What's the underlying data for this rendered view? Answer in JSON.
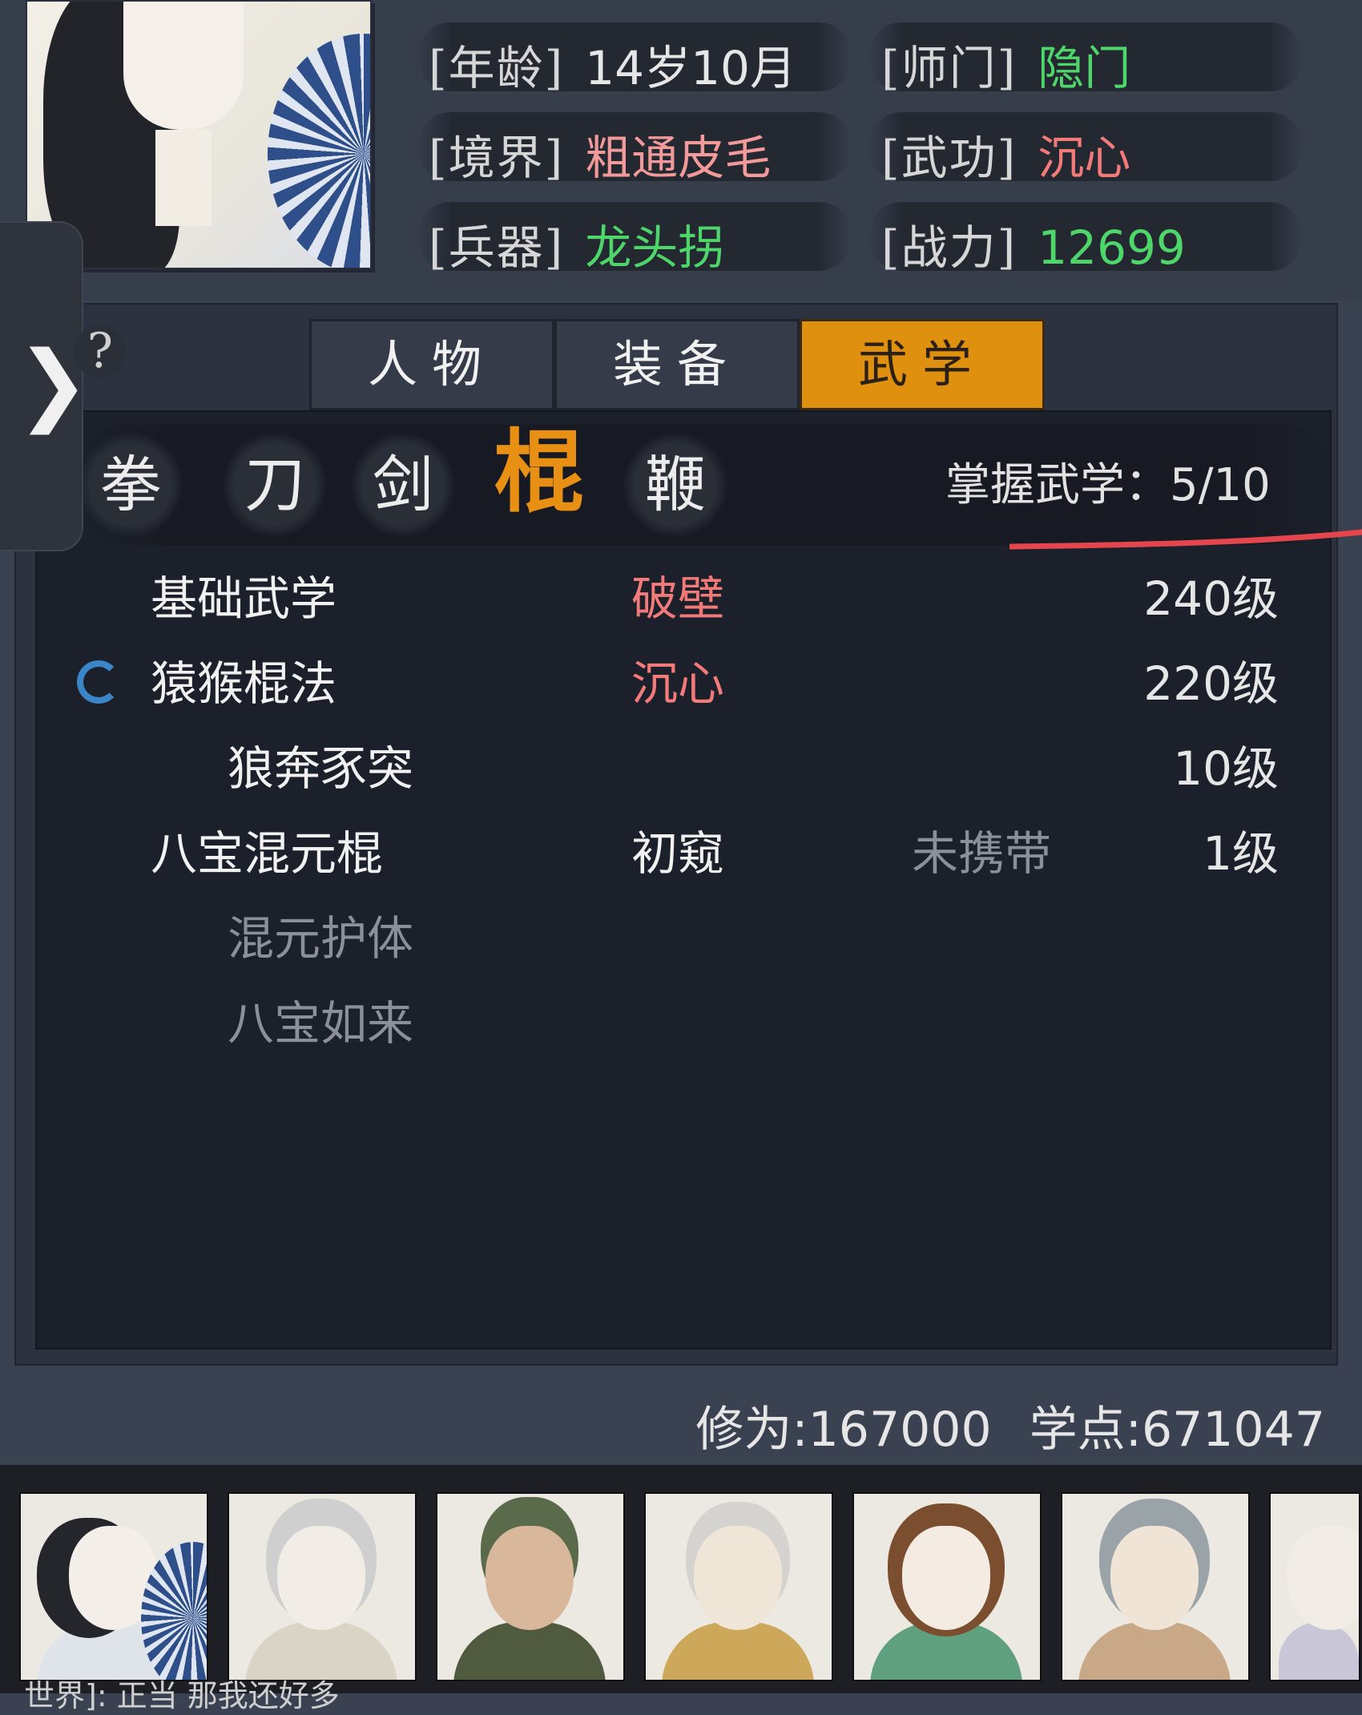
{
  "profile": {
    "age_label": "[年龄]",
    "age_value": "14岁10月",
    "sect_label": "[师门]",
    "sect_value": "隐门",
    "realm_label": "[境界]",
    "realm_value": "粗通皮毛",
    "martial_label": "[武功]",
    "martial_value": "沉心",
    "weapon_label": "[兵器]",
    "weapon_value": "龙头拐",
    "power_label": "[战力]",
    "power_value": "12699"
  },
  "side_tab": {
    "chevron": "❯"
  },
  "help": {
    "symbol": "?"
  },
  "tabs": [
    {
      "label": "人物",
      "active": false
    },
    {
      "label": "装备",
      "active": false
    },
    {
      "label": "武学",
      "active": true
    }
  ],
  "weapon_types": [
    {
      "label": "拳",
      "active": false
    },
    {
      "label": "刀",
      "active": false
    },
    {
      "label": "剑",
      "active": false
    },
    {
      "label": "棍",
      "active": true
    },
    {
      "label": "鞭",
      "active": false
    }
  ],
  "mastery": "掌握武学：5/10",
  "skills": [
    {
      "name": "基础武学",
      "stage": "破壁",
      "carry": "",
      "level": "240级",
      "indent": false,
      "dim": false,
      "spinning": false
    },
    {
      "name": "猿猴棍法",
      "stage": "沉心",
      "carry": "",
      "level": "220级",
      "indent": false,
      "dim": false,
      "spinning": true
    },
    {
      "name": "狼奔豕突",
      "stage": "",
      "carry": "",
      "level": "10级",
      "indent": true,
      "dim": false,
      "spinning": false
    },
    {
      "name": "八宝混元棍",
      "stage": "初窥",
      "carry": "未携带",
      "level": "1级",
      "indent": false,
      "dim": false,
      "spinning": false
    },
    {
      "name": "混元护体",
      "stage": "",
      "carry": "",
      "level": "",
      "indent": true,
      "dim": true,
      "spinning": false
    },
    {
      "name": "八宝如来",
      "stage": "",
      "carry": "",
      "level": "",
      "indent": true,
      "dim": true,
      "spinning": false
    }
  ],
  "stats": {
    "cultivation": "修为:167000",
    "study_points": "学点:671047"
  },
  "ticker": "世界]: 正当 那我还好多",
  "colors": {
    "accent": "#e0900f",
    "green": "#4fd66a",
    "red": "#f27a78",
    "dim": "#8b8f98",
    "spinner": "#3b86c9",
    "annotation": "#e5464e"
  },
  "icons": [
    "chevron-right-icon",
    "help-icon",
    "loading-spinner-icon"
  ]
}
